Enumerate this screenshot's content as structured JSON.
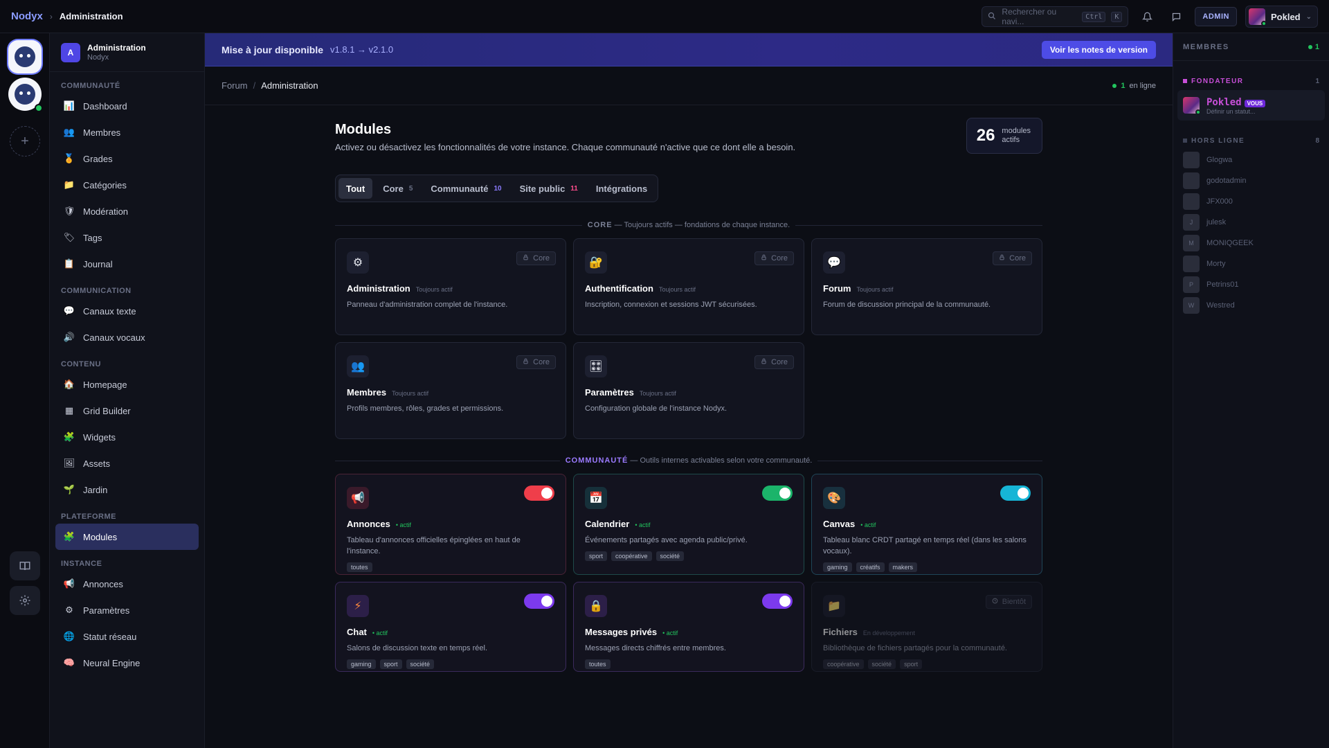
{
  "topbar": {
    "brand": "Nodyx",
    "crumb": "Administration",
    "search_placeholder": "Rechercher ou navi...",
    "kbd_ctrl": "Ctrl",
    "kbd_k": "K",
    "admin_badge": "ADMIN",
    "user": "Pokled"
  },
  "sidebar": {
    "header_title": "Administration",
    "header_sub": "Nodyx",
    "header_initial": "A",
    "sections": [
      {
        "label": "COMMUNAUTÉ",
        "items": [
          {
            "label": "Dashboard",
            "icon": "📊"
          },
          {
            "label": "Membres",
            "icon": "👥"
          },
          {
            "label": "Grades",
            "icon": "🏅"
          },
          {
            "label": "Catégories",
            "icon": "📁"
          },
          {
            "label": "Modération",
            "icon": "🛡"
          },
          {
            "label": "Tags",
            "icon": "🏷"
          },
          {
            "label": "Journal",
            "icon": "📋"
          }
        ]
      },
      {
        "label": "COMMUNICATION",
        "items": [
          {
            "label": "Canaux texte",
            "icon": "💬"
          },
          {
            "label": "Canaux vocaux",
            "icon": "🔊"
          }
        ]
      },
      {
        "label": "CONTENU",
        "items": [
          {
            "label": "Homepage",
            "icon": "🏠"
          },
          {
            "label": "Grid Builder",
            "icon": "▦"
          },
          {
            "label": "Widgets",
            "icon": "🧩"
          },
          {
            "label": "Assets",
            "icon": "🖼"
          },
          {
            "label": "Jardin",
            "icon": "🌱"
          }
        ]
      },
      {
        "label": "PLATEFORME",
        "items": [
          {
            "label": "Modules",
            "icon": "🧩",
            "active": true
          }
        ]
      },
      {
        "label": "INSTANCE",
        "items": [
          {
            "label": "Annonces",
            "icon": "📢"
          },
          {
            "label": "Paramètres",
            "icon": "⚙"
          },
          {
            "label": "Statut réseau",
            "icon": "🌐"
          },
          {
            "label": "Neural Engine",
            "icon": "🧠"
          }
        ]
      }
    ]
  },
  "banner": {
    "title": "Mise à jour disponible",
    "version": "v1.8.1 → v2.1.0",
    "button": "Voir les notes de version"
  },
  "breadcrumb": {
    "root": "Forum",
    "sep": "/",
    "current": "Administration",
    "online_count": "1",
    "online_label": "en ligne"
  },
  "modules": {
    "title": "Modules",
    "description": "Activez ou désactivez les fonctionnalités de votre instance. Chaque communauté n'active que ce dont elle a besoin.",
    "count": "26",
    "count_label_1": "modules",
    "count_label_2": "actifs",
    "tabs": [
      {
        "label": "Tout",
        "count": "",
        "active": true
      },
      {
        "label": "Core",
        "count": "5"
      },
      {
        "label": "Communauté",
        "count": "10"
      },
      {
        "label": "Site public",
        "count": "11"
      },
      {
        "label": "Intégrations",
        "count": ""
      }
    ],
    "core_heading": "CORE",
    "core_sub": " — Toujours actifs — fondations de chaque instance.",
    "community_heading": "COMMUNAUTÉ",
    "community_sub": " — Outils internes activables selon votre communauté.",
    "core_badge": "Core",
    "always_active": "Toujours actif",
    "active_label": "• actif",
    "soon_label": "Bientôt",
    "dev_label": "En développement",
    "core_cards": [
      {
        "name": "Administration",
        "desc": "Panneau d'administration complet de l'instance.",
        "icon": "⚙"
      },
      {
        "name": "Authentification",
        "desc": "Inscription, connexion et sessions JWT sécurisées.",
        "icon": "🔐"
      },
      {
        "name": "Forum",
        "desc": "Forum de discussion principal de la communauté.",
        "icon": "💬"
      },
      {
        "name": "Membres",
        "desc": "Profils membres, rôles, grades et permissions.",
        "icon": "👥"
      },
      {
        "name": "Paramètres",
        "desc": "Configuration globale de l'instance Nodyx.",
        "icon": "🎛"
      }
    ],
    "community_cards": [
      {
        "name": "Annonces",
        "desc": "Tableau d'annonces officielles épinglées en haut de l'instance.",
        "tags": [
          "toutes"
        ],
        "icon": "📢",
        "color": "pink",
        "toggle": "red"
      },
      {
        "name": "Calendrier",
        "desc": "Événements partagés avec agenda public/privé.",
        "tags": [
          "sport",
          "coopérative",
          "société"
        ],
        "icon": "📅",
        "color": "teal",
        "toggle": "green"
      },
      {
        "name": "Canvas",
        "desc": "Tableau blanc CRDT partagé en temps réel (dans les salons vocaux).",
        "tags": [
          "gaming",
          "créatifs",
          "makers"
        ],
        "icon": "🎨",
        "color": "cyan",
        "toggle": "cyan"
      },
      {
        "name": "Chat",
        "desc": "Salons de discussion texte en temps réel.",
        "tags": [
          "gaming",
          "sport",
          "société"
        ],
        "icon": "⚡",
        "color": "purple",
        "toggle": "violet"
      },
      {
        "name": "Messages privés",
        "desc": "Messages directs chiffrés entre membres.",
        "tags": [
          "toutes"
        ],
        "icon": "🔒",
        "color": "purple",
        "toggle": "violet"
      },
      {
        "name": "Fichiers",
        "desc": "Bibliothèque de fichiers partagés pour la communauté.",
        "tags": [
          "coopérative",
          "société",
          "sport"
        ],
        "icon": "📁",
        "color": "",
        "toggle": "",
        "soon": true
      }
    ]
  },
  "members": {
    "title": "MEMBRES",
    "online": "1",
    "founder_label": "FONDATEUR",
    "founder_count": "1",
    "me": {
      "name": "Pokled",
      "badge": "VOUS",
      "status": "Définir un statut..."
    },
    "offline_label": "HORS LIGNE",
    "offline_count": "8",
    "offline": [
      "Glogwa",
      "godotadmin",
      "JFX000",
      "julesk",
      "MONIQGEEK",
      "Morty",
      "Petrins01",
      "Westred"
    ],
    "offline_initials": [
      "",
      "",
      "",
      "J",
      "M",
      "",
      "P",
      "W"
    ]
  }
}
